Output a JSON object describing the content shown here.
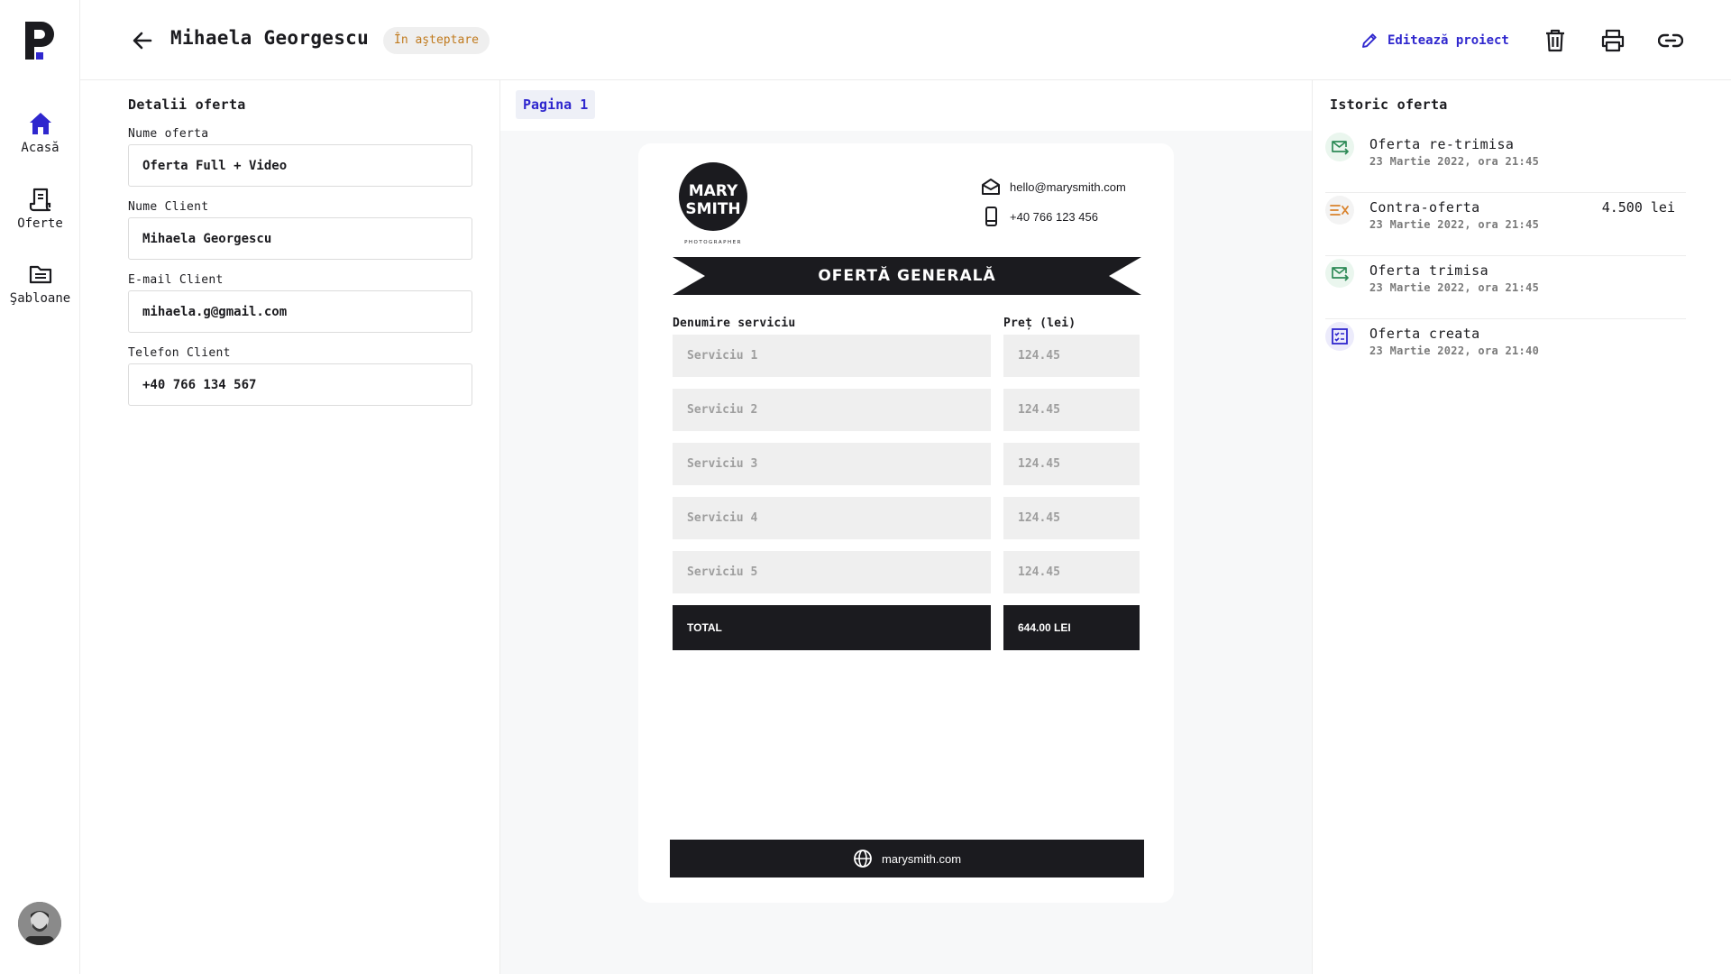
{
  "nav": {
    "items": [
      {
        "label": "Acasă",
        "icon": "home-icon"
      },
      {
        "label": "Oferte",
        "icon": "receipt-icon"
      },
      {
        "label": "Şabloane",
        "icon": "folder-icon"
      }
    ],
    "accent": "#2f27ce"
  },
  "header": {
    "title": "Mihaela Georgescu",
    "status": "În aşteptare",
    "edit_label": "Editează proiect"
  },
  "details": {
    "title": "Detalii oferta",
    "fields": [
      {
        "label": "Nume oferta",
        "value": "Oferta Full + Video"
      },
      {
        "label": "Nume Client",
        "value": "Mihaela Georgescu"
      },
      {
        "label": "E-mail Client",
        "value": "mihaela.g@gmail.com"
      },
      {
        "label": "Telefon Client",
        "value": "+40 766 134 567"
      }
    ]
  },
  "canvas": {
    "page_tab": "Pagina 1",
    "doc": {
      "brand_line1": "MARY",
      "brand_line2": "SMITH",
      "brand_tagline": "PHOTOGRAPHER",
      "email": "hello@marysmith.com",
      "phone": "+40 766 123 456",
      "banner": "OFERTĂ GENERALĂ",
      "col_service": "Denumire serviciu",
      "col_price": "Preț (lei)",
      "rows": [
        {
          "service": "Serviciu 1",
          "price": "124.45"
        },
        {
          "service": "Serviciu 2",
          "price": "124.45"
        },
        {
          "service": "Serviciu 3",
          "price": "124.45"
        },
        {
          "service": "Serviciu 4",
          "price": "124.45"
        },
        {
          "service": "Serviciu 5",
          "price": "124.45"
        }
      ],
      "total_label": "TOTAL",
      "total_value": "644.00 LEI",
      "website": "marysmith.com"
    }
  },
  "history": {
    "title": "Istoric oferta",
    "items": [
      {
        "name": "Oferta re-trimisa",
        "date": "23 Martie 2022, ora 21:45",
        "amount": "",
        "icon": "mail-forward-icon",
        "color": "#2e8b57",
        "bg": "#eaf6ee"
      },
      {
        "name": "Contra-oferta",
        "date": "23 Martie 2022, ora 21:45",
        "amount": "4.500 lei",
        "icon": "counter-offer-icon",
        "color": "#d9822b",
        "bg": "#f3f3f3"
      },
      {
        "name": "Oferta trimisa",
        "date": "23 Martie 2022, ora 21:45",
        "amount": "",
        "icon": "mail-sent-icon",
        "color": "#2e8b57",
        "bg": "#eaf6ee"
      },
      {
        "name": "Oferta creata",
        "date": "23 Martie 2022, ora 21:40",
        "amount": "",
        "icon": "checklist-icon",
        "color": "#2f27ce",
        "bg": "#ecebfb"
      }
    ]
  }
}
